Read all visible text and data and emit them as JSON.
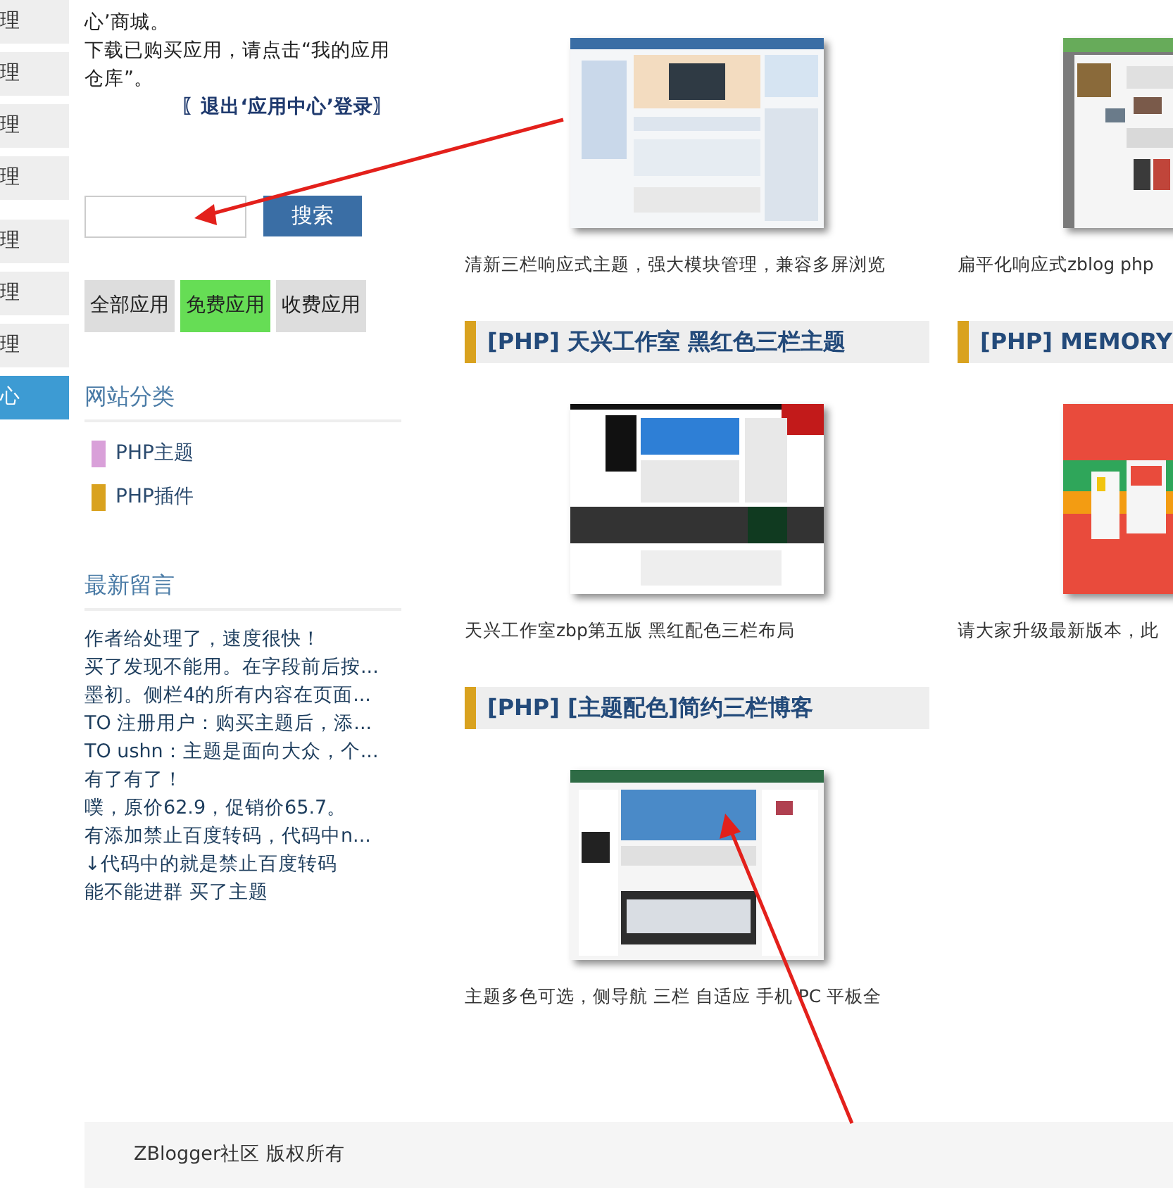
{
  "nav_items": [
    {
      "label": "理",
      "selected": false
    },
    {
      "label": "理",
      "selected": false
    },
    {
      "label": "理",
      "selected": false
    },
    {
      "label": "理",
      "selected": false
    },
    {
      "label": "理",
      "selected": false
    },
    {
      "label": "理",
      "selected": false
    },
    {
      "label": "理",
      "selected": false
    },
    {
      "label": "心",
      "selected": true
    }
  ],
  "intro": {
    "lines": [
      "心’商城。",
      "下载已购买应用，请点击“我的应用",
      "仓库”。"
    ],
    "logout_link": "〖退出‘应用中心’登录〗"
  },
  "search": {
    "button": "搜索"
  },
  "filters": [
    {
      "label": "全部应用",
      "selected": false
    },
    {
      "label": "免费应用",
      "selected": true
    },
    {
      "label": "收费应用",
      "selected": false
    }
  ],
  "categories": {
    "title": "网站分类",
    "items": [
      {
        "label": "PHP主题",
        "color": "#d9a0d9"
      },
      {
        "label": "PHP插件",
        "color": "#d9a21f"
      }
    ]
  },
  "comments": {
    "title": "最新留言",
    "items": [
      "作者给处理了，速度很快！",
      "买了发现不能用。在字段前后按...",
      "墨初。侧栏4的所有内容在页面...",
      "TO 注册用户：购买主题后，添...",
      "TO ushn：主题是面向大众，个...",
      "有了有了！",
      "噗，原价62.9，促销价65.7。",
      "有添加禁止百度转码，代码中n...",
      "↓代码中的就是禁止百度转码",
      "能不能进群 买了主题"
    ]
  },
  "apps": [
    {
      "caption": "清新三栏响应式主题，强大模块管理，兼容多屏浏览"
    },
    {
      "caption": "扁平化响应式zblog php"
    },
    {
      "title": "[PHP] 天兴工作室 黑红色三栏主题",
      "caption": "天兴工作室zbp第五版 黑红配色三栏布局"
    },
    {
      "title": "[PHP] MEMORY",
      "caption": "请大家升级最新版本，此"
    },
    {
      "title": "[PHP] [主题配色]简约三栏博客",
      "caption": "主题多色可选，侧导航 三栏 自适应 手机 PC 平板全"
    }
  ],
  "footer": {
    "text": "ZBlogger社区 版权所有"
  }
}
